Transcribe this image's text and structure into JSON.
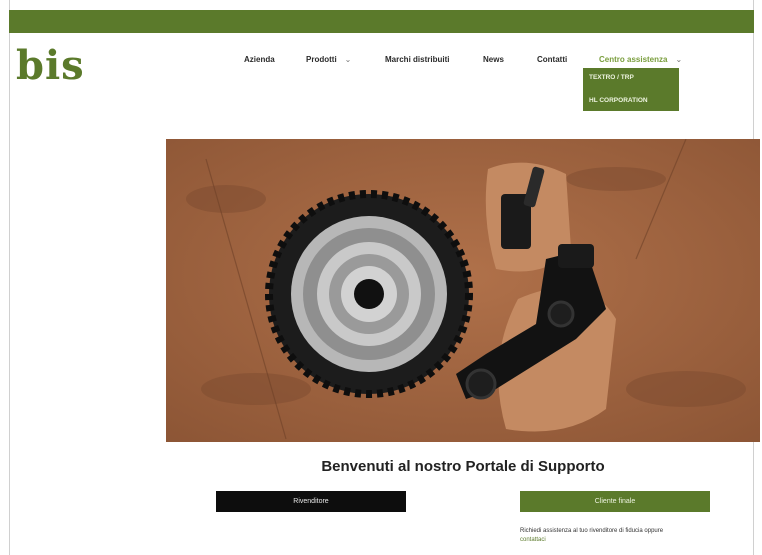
{
  "brand": {
    "logo_text": "bis",
    "accent": "#5b7a2b"
  },
  "nav": {
    "items": [
      {
        "label": "Azienda",
        "chevron": false
      },
      {
        "label": "Prodotti",
        "chevron": true
      },
      {
        "label": "Marchi distribuiti",
        "chevron": false
      },
      {
        "label": "News",
        "chevron": false
      },
      {
        "label": "Contatti",
        "chevron": false
      },
      {
        "label": "Centro assistenza",
        "chevron": true
      }
    ],
    "dropdown": [
      "TEXTRO / TRP",
      "HL CORPORATION"
    ]
  },
  "hero": {
    "icon": "bike-drivetrain-photo"
  },
  "main": {
    "welcome": "Benvenuti al nostro Portale di Supporto",
    "buttons": {
      "dealer": "Rivenditore",
      "end_user": "Cliente finale"
    },
    "note_text": "Richiedi assistenza al tuo rivenditore di fiducia oppure",
    "note_link": "contattaci"
  }
}
